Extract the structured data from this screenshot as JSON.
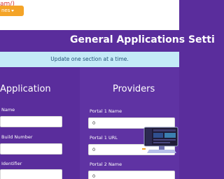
{
  "header": {
    "link_text": "am/)",
    "dropdown_label": "nes"
  },
  "page": {
    "title": "General Applications Setti",
    "notice": "Update one section at a time."
  },
  "application": {
    "heading": "Application",
    "fields": [
      {
        "label": "Name",
        "value": ""
      },
      {
        "label": "Build Number",
        "value": ""
      },
      {
        "label": "Identifier",
        "value": ""
      }
    ]
  },
  "providers": {
    "heading": "Providers",
    "fields": [
      {
        "label": "Portal 1 Name",
        "value": "0"
      },
      {
        "label": "Portal 1 URL",
        "value": "0"
      },
      {
        "label": "Portal 2 Name",
        "value": "0"
      }
    ]
  },
  "colors": {
    "background": "#5a2d9c",
    "accent": "#f4a428",
    "notice_bg": "#c4eaf7",
    "link": "#d83a3a"
  },
  "icons": [
    "caret-down-icon",
    "computer-monitor-illustration"
  ]
}
